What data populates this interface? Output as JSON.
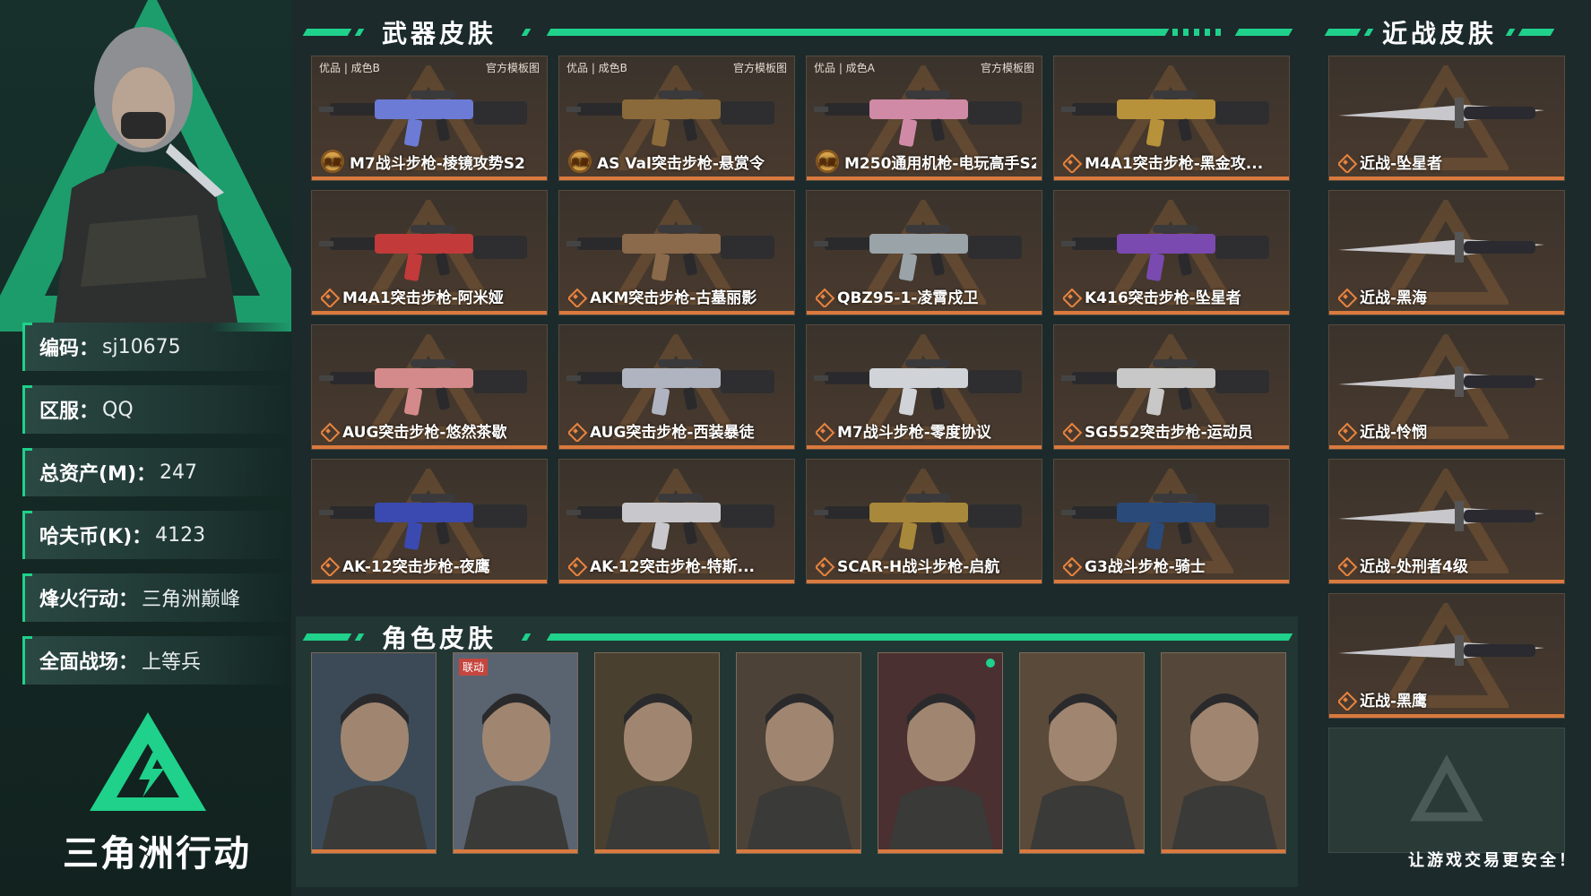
{
  "left": {
    "brand_name": "三角洲行动",
    "info": [
      {
        "key": "编码：",
        "value": "sj10675"
      },
      {
        "key": "区服：",
        "value": "QQ"
      },
      {
        "key": "总资产(M)：",
        "value": "247"
      },
      {
        "key": "哈夫币(K)：",
        "value": "4123"
      },
      {
        "key": "烽火行动：",
        "value": "三角洲巅峰"
      },
      {
        "key": "全面战场：",
        "value": "上等兵"
      }
    ]
  },
  "weapons": {
    "title": "武器皮肤",
    "items": [
      {
        "tag_left": "优品 | 成色B",
        "tag_right": "官方模板图",
        "name": "M7战斗步枪-棱镜攻势S2",
        "icon": "seal",
        "accent": "#6b7bd6"
      },
      {
        "tag_left": "优品 | 成色B",
        "tag_right": "官方模板图",
        "name": "AS Val突击步枪-悬赏令",
        "icon": "seal",
        "accent": "#8a6a3a"
      },
      {
        "tag_left": "优品 | 成色A",
        "tag_right": "官方模板图",
        "name": "M250通用机枪-电玩高手S2",
        "icon": "seal",
        "accent": "#d08aa6"
      },
      {
        "tag_left": "",
        "tag_right": "",
        "name": "M4A1突击步枪-黑金攻...",
        "icon": "diamond",
        "accent": "#b8923a"
      },
      {
        "tag_left": "",
        "tag_right": "",
        "name": "M4A1突击步枪-阿米娅",
        "icon": "diamond",
        "accent": "#c23a3a"
      },
      {
        "tag_left": "",
        "tag_right": "",
        "name": "AKM突击步枪-古墓丽影",
        "icon": "diamond",
        "accent": "#8a6a4a"
      },
      {
        "tag_left": "",
        "tag_right": "",
        "name": "QBZ95-1-凌霄戍卫",
        "icon": "diamond",
        "accent": "#9aa3a8"
      },
      {
        "tag_left": "",
        "tag_right": "",
        "name": "K416突击步枪-坠星者",
        "icon": "diamond",
        "accent": "#7a4ab0"
      },
      {
        "tag_left": "",
        "tag_right": "",
        "name": "AUG突击步枪-悠然茶歇",
        "icon": "diamond",
        "accent": "#d48a8a"
      },
      {
        "tag_left": "",
        "tag_right": "",
        "name": "AUG突击步枪-西装暴徒",
        "icon": "diamond",
        "accent": "#b0b4c0"
      },
      {
        "tag_left": "",
        "tag_right": "",
        "name": "M7战斗步枪-零度协议",
        "icon": "diamond",
        "accent": "#d0d4d8"
      },
      {
        "tag_left": "",
        "tag_right": "",
        "name": "SG552突击步枪-运动员",
        "icon": "diamond",
        "accent": "#c8c8c8"
      },
      {
        "tag_left": "",
        "tag_right": "",
        "name": "AK-12突击步枪-夜鹰",
        "icon": "diamond",
        "accent": "#3a4ab0"
      },
      {
        "tag_left": "",
        "tag_right": "",
        "name": "AK-12突击步枪-特斯...",
        "icon": "diamond",
        "accent": "#c8c8cc"
      },
      {
        "tag_left": "",
        "tag_right": "",
        "name": "SCAR-H战斗步枪-启航",
        "icon": "diamond",
        "accent": "#a8883a"
      },
      {
        "tag_left": "",
        "tag_right": "",
        "name": "G3战斗步枪-骑士",
        "icon": "diamond",
        "accent": "#2a4a7a"
      }
    ]
  },
  "roles": {
    "title": "角色皮肤",
    "items": [
      {
        "badge": "",
        "dot": false,
        "tone": "#3b4a56"
      },
      {
        "badge": "联动",
        "dot": false,
        "tone": "#5a6470"
      },
      {
        "badge": "",
        "dot": false,
        "tone": "#4a4030"
      },
      {
        "badge": "",
        "dot": false,
        "tone": "#4c4238"
      },
      {
        "badge": "",
        "dot": true,
        "tone": "#4a3030"
      },
      {
        "badge": "",
        "dot": false,
        "tone": "#5a4a3a"
      },
      {
        "badge": "",
        "dot": false,
        "tone": "#55483a"
      }
    ]
  },
  "melee": {
    "title": "近战皮肤",
    "items": [
      {
        "name": "近战-坠星者"
      },
      {
        "name": "近战-黑海"
      },
      {
        "name": "近战-怜悯"
      },
      {
        "name": "近战-处刑者4级"
      },
      {
        "name": "近战-黑鹰"
      }
    ]
  },
  "slogan": "让游戏交易更安全！"
}
